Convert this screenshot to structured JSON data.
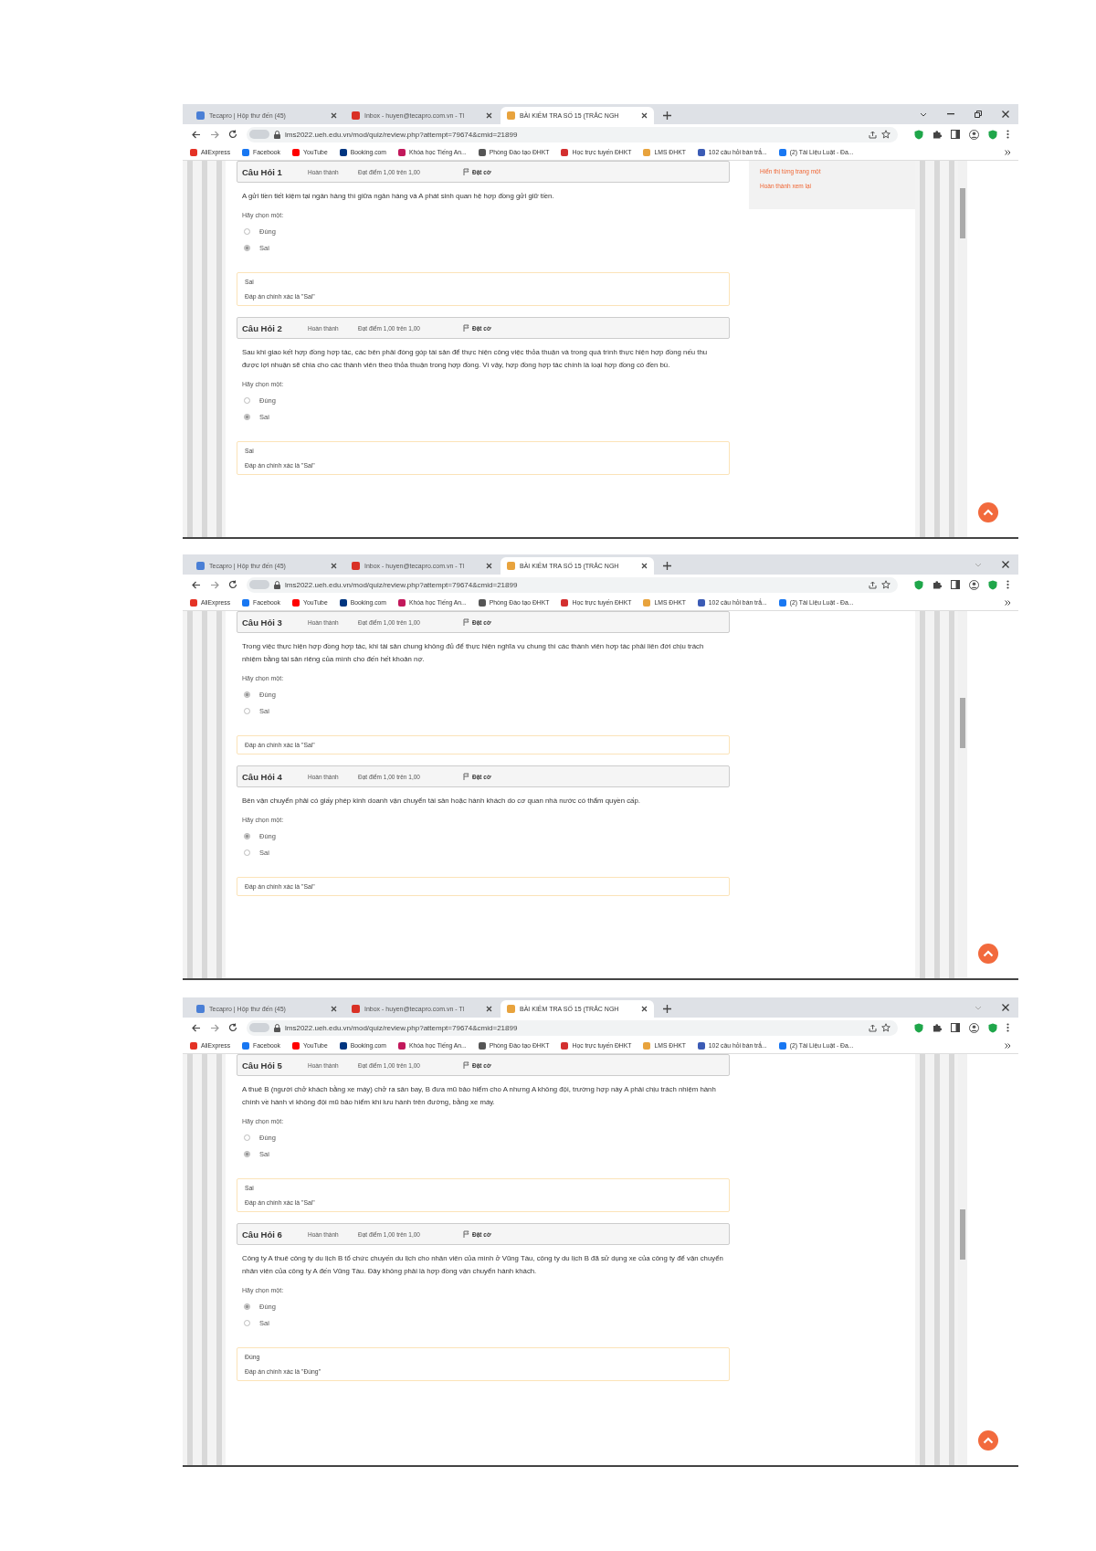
{
  "screenshots": [
    {
      "tabs": [
        {
          "title": "Tecapro | Hộp thư đến (45)",
          "selected": false,
          "color": "#4a7fd6"
        },
        {
          "title": "Inbox - huyen@tecapro.com.vn - Tl",
          "selected": false,
          "color": "#d93025"
        },
        {
          "title": "BÀI KIỂM TRA SỐ 15 (TRẮC NGH",
          "selected": true,
          "color": "#e8a33d"
        }
      ],
      "full_window_controls": true,
      "url": "lms2022.ueh.edu.vn/mod/quiz/review.php?attempt=79674&cmid=21899",
      "bookmarks": [
        {
          "label": "AliExpress",
          "color": "#e43225"
        },
        {
          "label": "Facebook",
          "color": "#1877f2"
        },
        {
          "label": "YouTube",
          "color": "#ff0000"
        },
        {
          "label": "Booking.com",
          "color": "#003580"
        },
        {
          "label": "Khóa học Tiếng An...",
          "color": "#c2185b"
        },
        {
          "label": "Phòng Đào tạo ĐHKT",
          "color": "#555555"
        },
        {
          "label": "Học trực tuyến ĐHKT",
          "color": "#d32f2f"
        },
        {
          "label": "LMS ĐHKT",
          "color": "#e8a33d"
        },
        {
          "label": "102 câu hỏi bán trắ...",
          "color": "#3b5bb5"
        },
        {
          "label": "(2) Tài Liệu Luật - Đa...",
          "color": "#1877f2"
        }
      ],
      "nav_links": [
        "Hiển thị từng trang một",
        "Hoàn thành xem lại"
      ],
      "content": [
        {
          "kind": "question",
          "number": "Câu Hỏi 1",
          "status": "Hoàn thành",
          "grade": "Đạt điểm 1,00 trên 1,00",
          "flag": "Đặt cờ",
          "text": "A gửi tiền tiết kiệm tại ngân hàng thì giữa ngân hàng và A phát sinh quan hệ hợp đồng gửi giữ tiền.",
          "prompt": "Hãy chọn một:",
          "options": [
            {
              "label": "Đúng",
              "selected": false
            },
            {
              "label": "Sai",
              "selected": true
            }
          ]
        },
        {
          "kind": "feedback",
          "lines": [
            "Sai",
            "Đáp án chính xác là \"Sai\""
          ]
        },
        {
          "kind": "question",
          "number": "Câu Hỏi 2",
          "status": "Hoàn thành",
          "grade": "Đạt điểm 1,00 trên 1,00",
          "flag": "Đặt cờ",
          "text": "Sau khi giao kết hợp đồng hợp tác, các bên phải đóng góp tài sản để thực hiện công việc thỏa thuận và trong quá trình thực hiện hợp đồng nếu thu được lợi nhuận sẽ chia cho các thành viên theo thỏa thuận trong hợp đồng. Vì vậy, hợp đồng hợp tác chính là loại hợp đồng có đền bù.",
          "prompt": "Hãy chọn một:",
          "options": [
            {
              "label": "Đúng",
              "selected": false
            },
            {
              "label": "Sai",
              "selected": true
            }
          ]
        },
        {
          "kind": "feedback",
          "lines": [
            "Sai",
            "Đáp án chính xác là \"Sai\""
          ]
        }
      ]
    },
    {
      "tabs": [
        {
          "title": "Tecapro | Hộp thư đến (45)",
          "selected": false,
          "color": "#4a7fd6"
        },
        {
          "title": "Inbox - huyen@tecapro.com.vn - Tl",
          "selected": false,
          "color": "#d93025"
        },
        {
          "title": "BÀI KIỂM TRA SỐ 15 (TRẮC NGH",
          "selected": true,
          "color": "#e8a33d"
        }
      ],
      "full_window_controls": false,
      "url": "lms2022.ueh.edu.vn/mod/quiz/review.php?attempt=79674&cmid=21899",
      "bookmarks": [
        {
          "label": "AliExpress",
          "color": "#e43225"
        },
        {
          "label": "Facebook",
          "color": "#1877f2"
        },
        {
          "label": "YouTube",
          "color": "#ff0000"
        },
        {
          "label": "Booking.com",
          "color": "#003580"
        },
        {
          "label": "Khóa học Tiếng An...",
          "color": "#c2185b"
        },
        {
          "label": "Phòng Đào tạo ĐHKT",
          "color": "#555555"
        },
        {
          "label": "Học trực tuyến ĐHKT",
          "color": "#d32f2f"
        },
        {
          "label": "LMS ĐHKT",
          "color": "#e8a33d"
        },
        {
          "label": "102 câu hỏi bán trắ...",
          "color": "#3b5bb5"
        },
        {
          "label": "(2) Tài Liệu Luật - Đa...",
          "color": "#1877f2"
        }
      ],
      "content": [
        {
          "kind": "question",
          "number": "Câu Hỏi 3",
          "status": "Hoàn thành",
          "grade": "Đạt điểm 1,00 trên 1,00",
          "flag": "Đặt cờ",
          "text": "Trong việc thực hiện hợp đồng hợp tác, khi tài sản chung không đủ để thực hiện nghĩa vụ chung thì các thành viên hợp tác phải liên đới chịu trách nhiệm bằng tài sản riêng của mình cho đến hết khoản nợ.",
          "prompt": "Hãy chọn một:",
          "options": [
            {
              "label": "Đúng",
              "selected": true
            },
            {
              "label": "Sai",
              "selected": false
            }
          ]
        },
        {
          "kind": "feedback",
          "lines": [
            "Đáp án chính xác là \"Sai\""
          ]
        },
        {
          "kind": "question",
          "number": "Câu Hỏi 4",
          "status": "Hoàn thành",
          "grade": "Đạt điểm 1,00 trên 1,00",
          "flag": "Đặt cờ",
          "text": "Bên vận chuyển phải có giấy phép kinh doanh vận chuyển tài sản hoặc hành khách do cơ quan nhà nước có thẩm quyền cấp.",
          "prompt": "Hãy chọn một:",
          "options": [
            {
              "label": "Đúng",
              "selected": true
            },
            {
              "label": "Sai",
              "selected": false
            }
          ]
        },
        {
          "kind": "feedback",
          "lines": [
            "Đáp án chính xác là \"Sai\""
          ]
        }
      ]
    },
    {
      "tabs": [
        {
          "title": "Tecapro | Hộp thư đến (45)",
          "selected": false,
          "color": "#4a7fd6"
        },
        {
          "title": "Inbox - huyen@tecapro.com.vn - Tl",
          "selected": false,
          "color": "#d93025"
        },
        {
          "title": "BÀI KIỂM TRA SỐ 15 (TRẮC NGH",
          "selected": true,
          "color": "#e8a33d"
        }
      ],
      "full_window_controls": false,
      "url": "lms2022.ueh.edu.vn/mod/quiz/review.php?attempt=79674&cmid=21899",
      "bookmarks": [
        {
          "label": "AliExpress",
          "color": "#e43225"
        },
        {
          "label": "Facebook",
          "color": "#1877f2"
        },
        {
          "label": "YouTube",
          "color": "#ff0000"
        },
        {
          "label": "Booking.com",
          "color": "#003580"
        },
        {
          "label": "Khóa học Tiếng An...",
          "color": "#c2185b"
        },
        {
          "label": "Phòng Đào tạo ĐHKT",
          "color": "#555555"
        },
        {
          "label": "Học trực tuyến ĐHKT",
          "color": "#d32f2f"
        },
        {
          "label": "LMS ĐHKT",
          "color": "#e8a33d"
        },
        {
          "label": "102 câu hỏi bán trắ...",
          "color": "#3b5bb5"
        },
        {
          "label": "(2) Tài Liệu Luật - Đa...",
          "color": "#1877f2"
        }
      ],
      "content": [
        {
          "kind": "question",
          "number": "Câu Hỏi 5",
          "status": "Hoàn thành",
          "grade": "Đạt điểm 1,00 trên 1,00",
          "flag": "Đặt cờ",
          "text": "A thuê B (người chở khách bằng xe máy) chở ra sân bay, B đưa mũ bảo hiểm cho A nhưng A không đội, trường hợp này A phải chịu trách nhiệm hành chính về hành vi không đội mũ bảo hiểm khi lưu hành trên đường, bằng xe máy.",
          "prompt": "Hãy chọn một:",
          "options": [
            {
              "label": "Đúng",
              "selected": false
            },
            {
              "label": "Sai",
              "selected": true
            }
          ]
        },
        {
          "kind": "feedback",
          "lines": [
            "Sai",
            "Đáp án chính xác là \"Sai\""
          ]
        },
        {
          "kind": "question",
          "number": "Câu Hỏi 6",
          "status": "Hoàn thành",
          "grade": "Đạt điểm 1,00 trên 1,00",
          "flag": "Đặt cờ",
          "text": "Công ty A thuê công ty du lịch B tổ chức chuyến du lịch cho nhân viên của mình ở Vũng Tàu, công ty du lịch B đã sử dụng xe của công ty để vận chuyển nhân viên của công ty A đến Vũng Tàu. Đây không phải là hợp đồng vận chuyển hành khách.",
          "prompt": "Hãy chọn một:",
          "options": [
            {
              "label": "Đúng",
              "selected": true
            },
            {
              "label": "Sai",
              "selected": false
            }
          ]
        },
        {
          "kind": "feedback",
          "lines": [
            "Đúng",
            "Đáp án chính xác là \"Đúng\""
          ]
        }
      ]
    }
  ]
}
